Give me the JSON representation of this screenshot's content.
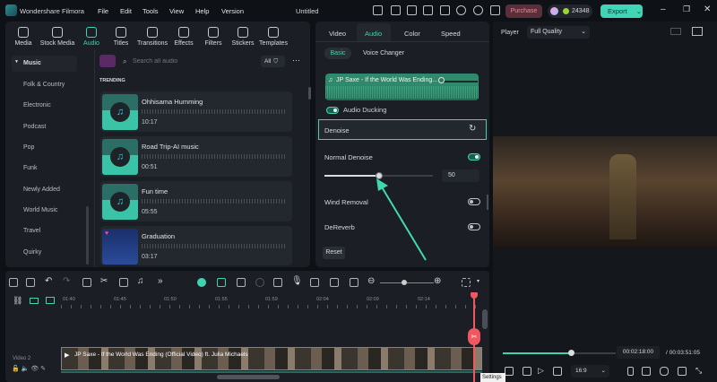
{
  "app": {
    "name": "Wondershare Filmora",
    "doc_title": "Untitled",
    "menu": [
      "File",
      "Edit",
      "Tools",
      "View",
      "Help",
      "Version"
    ],
    "purchase": "Purchase",
    "credits": "24348",
    "export": "Export"
  },
  "nav": [
    {
      "label": "Media",
      "icon": "media-icon"
    },
    {
      "label": "Stock Media",
      "icon": "stock-media-icon"
    },
    {
      "label": "Audio",
      "icon": "music-note-icon"
    },
    {
      "label": "Titles",
      "icon": "titles-icon"
    },
    {
      "label": "Transitions",
      "icon": "transitions-icon"
    },
    {
      "label": "Effects",
      "icon": "effects-icon"
    },
    {
      "label": "Filters",
      "icon": "filters-icon"
    },
    {
      "label": "Stickers",
      "icon": "stickers-icon"
    },
    {
      "label": "Templates",
      "icon": "templates-icon"
    }
  ],
  "categories": {
    "parent": "Music",
    "items": [
      "Folk & Country",
      "Electronic",
      "Podcast",
      "Pop",
      "Funk",
      "Newly Added",
      "World Music",
      "Travel",
      "Quirky"
    ]
  },
  "audio_list": {
    "search_placeholder": "Search all audio",
    "filter": "All",
    "section": "TRENDING",
    "items": [
      {
        "title": "Ohhisama Humming",
        "duration": "10:17"
      },
      {
        "title": "Road Trip-AI music",
        "duration": "00:51"
      },
      {
        "title": "Fun time",
        "duration": "05:55"
      },
      {
        "title": "Graduation",
        "duration": "03:17"
      }
    ]
  },
  "properties": {
    "tabs": [
      "Video",
      "Audio",
      "Color",
      "Speed"
    ],
    "active_tab": "Audio",
    "subtabs": [
      "Basic",
      "Voice Changer"
    ],
    "clip_name": "JP Saxe - If the World Was Ending...",
    "ducking_label": "Audio Ducking",
    "denoise": "Denoise",
    "normal_denoise": "Normal Denoise",
    "normal_denoise_on": true,
    "denoise_value": "50",
    "denoise_fraction": 0.5,
    "wind_removal": "Wind Removal",
    "wind_removal_on": false,
    "dereverb": "DeReverb",
    "dereverb_on": false,
    "reset": "Reset"
  },
  "player": {
    "label": "Player",
    "quality": "Full Quality",
    "current_time": "00:02:18:00",
    "total_time": "/ 00:03:51:05",
    "progress": 0.6,
    "aspect": "16:9"
  },
  "timeline": {
    "ticks": [
      "01:40",
      "01:45",
      "01:50",
      "01:55",
      "01:59",
      "02:04",
      "02:09",
      "02:14"
    ],
    "track_label": "Video 2",
    "clip_title": "JP Saxe - If the World Was Ending (Official Video) ft. Julia Michaels",
    "tooltip": "Settings"
  },
  "colors": {
    "accent": "#40d3b1",
    "playhead": "#f0575e"
  }
}
